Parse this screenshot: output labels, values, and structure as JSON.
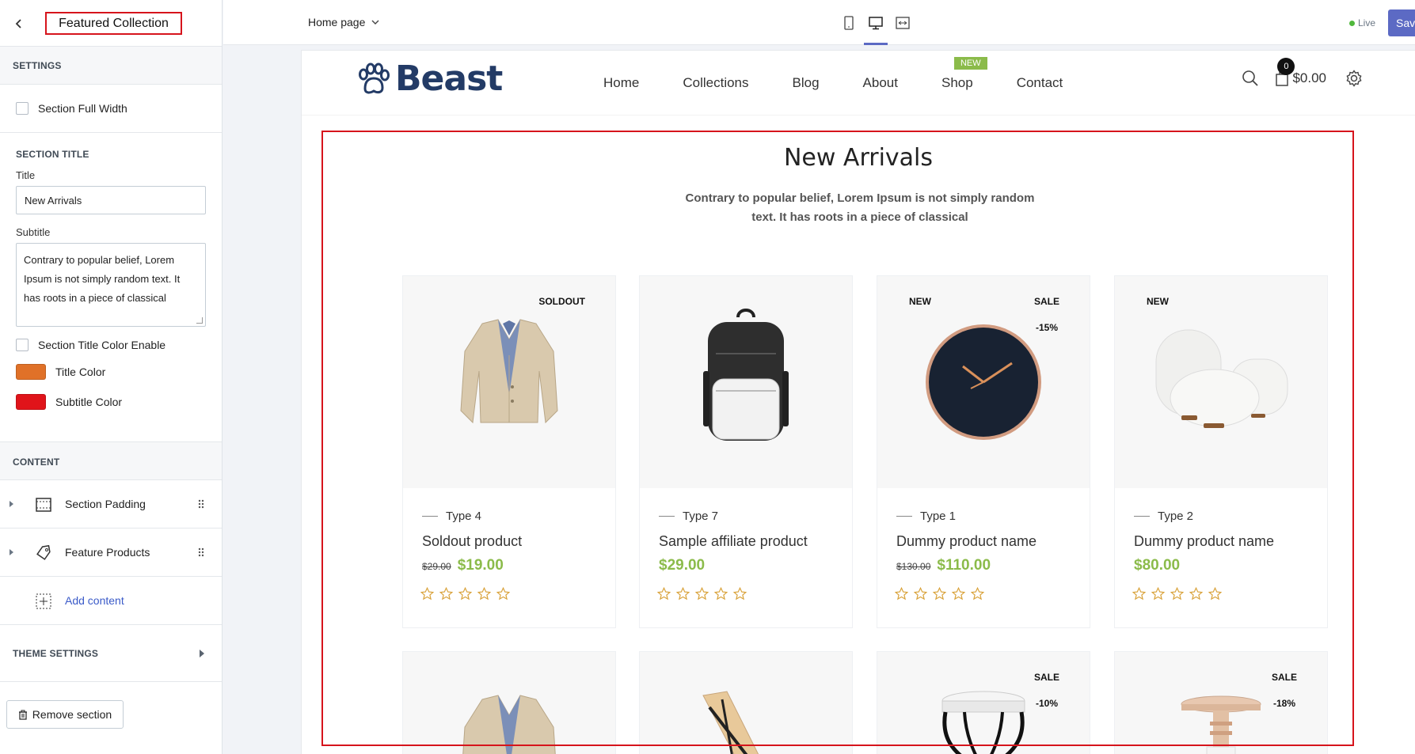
{
  "sidebar": {
    "title": "Featured Collection",
    "settings_heading": "SETTINGS",
    "section_full_width": "Section Full Width",
    "section_title_heading": "SECTION TITLE",
    "title_label": "Title",
    "title_value": "New Arrivals",
    "subtitle_label": "Subtitle",
    "subtitle_value": "Contrary to popular belief, Lorem Ipsum is not simply random text. It has roots in a piece of classical",
    "title_color_enable": "Section Title Color Enable",
    "title_color_label": "Title Color",
    "title_color": "#e07128",
    "subtitle_color_label": "Subtitle Color",
    "subtitle_color": "#e0141a",
    "content_heading": "CONTENT",
    "content_items": [
      {
        "label": "Section Padding",
        "icon": "padding-icon"
      },
      {
        "label": "Feature Products",
        "icon": "tag-icon"
      }
    ],
    "add_content": "Add content",
    "theme_settings": "THEME SETTINGS",
    "remove_section": "Remove section"
  },
  "topbar": {
    "page_select": "Home page",
    "live": "Live",
    "save": "Save",
    "devices": [
      "mobile-icon",
      "desktop-icon",
      "fullwidth-icon"
    ],
    "active_device": "desktop-icon"
  },
  "store": {
    "logo": "Beast",
    "nav": [
      "Home",
      "Collections",
      "Blog",
      "About",
      "Shop",
      "Contact"
    ],
    "nav_badge": "NEW",
    "cart_count": "0",
    "cart_total": "$0.00",
    "accent": "#8bbb4a"
  },
  "section": {
    "title": "New Arrivals",
    "subtitle_line1": "Contrary to popular belief, Lorem Ipsum is not simply random",
    "subtitle_line2": "text. It has roots in a piece of classical"
  },
  "products": [
    {
      "badge_left": "",
      "badge_right": "SOLDOUT",
      "badge_pct": "",
      "type": "Type 4",
      "name": "Soldout product",
      "price_old": "$29.00",
      "price": "$19.00",
      "image": "blazer",
      "rating": 0
    },
    {
      "badge_left": "",
      "badge_right": "",
      "badge_pct": "",
      "type": "Type 7",
      "name": "Sample affiliate product",
      "price_old": "",
      "price": "$29.00",
      "image": "backpack",
      "rating": 0
    },
    {
      "badge_left": "NEW",
      "badge_right": "SALE",
      "badge_pct": "-15%",
      "type": "Type 1",
      "name": "Dummy product name",
      "price_old": "$130.00",
      "price": "$110.00",
      "image": "clock",
      "rating": 0
    },
    {
      "badge_left": "NEW",
      "badge_right": "",
      "badge_pct": "",
      "type": "Type 2",
      "name": "Dummy product name",
      "price_old": "",
      "price": "$80.00",
      "image": "poufs",
      "rating": 0
    }
  ],
  "row2": [
    {
      "badge_right": "",
      "badge_pct": "",
      "image": "blazer"
    },
    {
      "badge_right": "",
      "badge_pct": "",
      "image": "chair"
    },
    {
      "badge_right": "SALE",
      "badge_pct": "-10%",
      "image": "stool-black"
    },
    {
      "badge_right": "SALE",
      "badge_pct": "-18%",
      "image": "stool-wood"
    }
  ]
}
